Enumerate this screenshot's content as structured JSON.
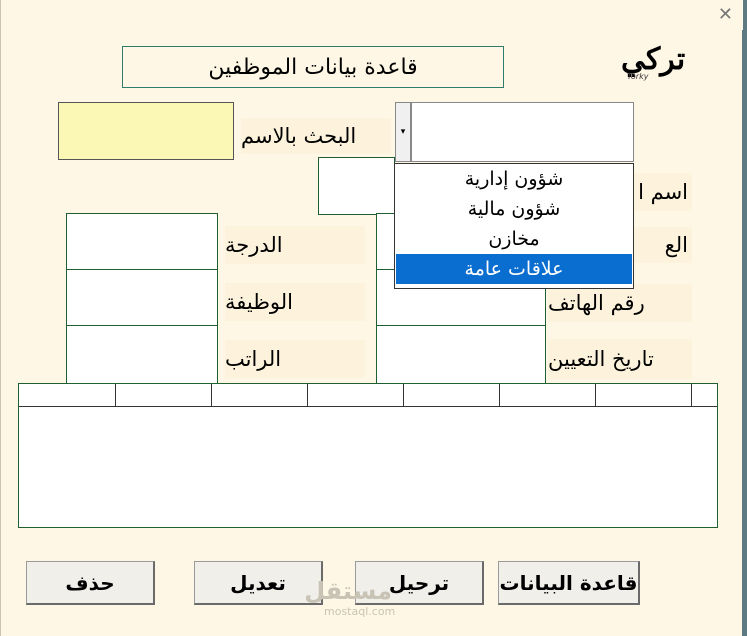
{
  "window": {
    "close_glyph": "✕"
  },
  "header": {
    "title": "قاعدة بيانات الموظفين"
  },
  "logo": {
    "arabic": "تركي",
    "latin": "Torky"
  },
  "search": {
    "label": "البحث بالاسم"
  },
  "dropdown": {
    "arrow": "▾",
    "options": [
      "شؤون إدارية",
      "شؤون مالية",
      "مخازن",
      "علاقات عامة"
    ],
    "selected_index": 3
  },
  "fields_left": {
    "grade_label": "الدرجة",
    "job_label": "الوظيفة",
    "salary_label": "الراتب"
  },
  "fields_right": {
    "name_label_partial": "اسم ا",
    "second_label_partial": "الع",
    "phone_label": "رقم الهاتف",
    "hire_date_label": "تاريخ التعيين"
  },
  "buttons": {
    "delete": "حذف",
    "edit": "تعديل",
    "post": "ترحيل",
    "database": "قاعدة البيانات"
  },
  "watermark": {
    "arabic": "مستقل",
    "latin": "mostaql.com"
  }
}
